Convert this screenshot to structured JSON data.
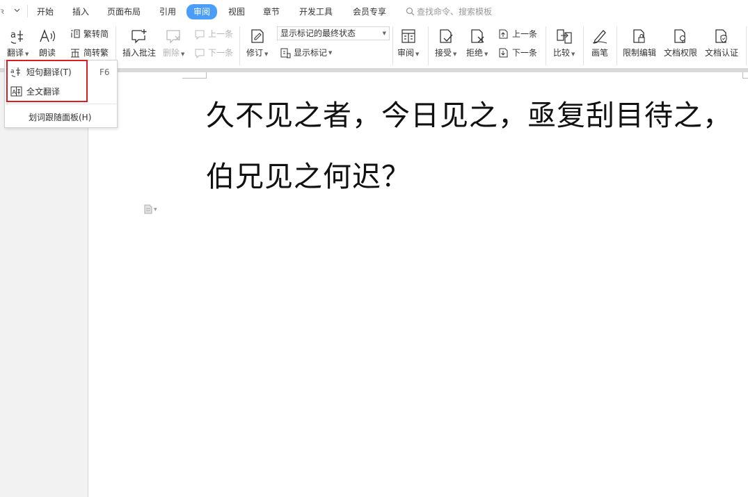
{
  "tabs": [
    "开始",
    "插入",
    "页面布局",
    "引用",
    "审阅",
    "视图",
    "章节",
    "开发工具",
    "会员专享"
  ],
  "active_tab": "审阅",
  "search_placeholder": "查找命令、搜索模板",
  "ribbon": {
    "translate": "翻译",
    "read_aloud": "朗读",
    "trad_to_simp": "繁转简",
    "simp_to_trad": "简转繁",
    "insert_comment": "插入批注",
    "delete": "删除",
    "prev_comment": "上一条",
    "next_comment": "下一条",
    "revise": "修订",
    "markup_state": "显示标记的最终状态",
    "show_markup": "显示标记",
    "review": "审阅",
    "accept": "接受",
    "reject": "拒绝",
    "prev_change": "上一条",
    "next_change": "下一条",
    "compare": "比较",
    "pen": "画笔",
    "restrict_edit": "限制编辑",
    "doc_permission": "文档权限",
    "doc_certify": "文档认证"
  },
  "menu": {
    "short_translate": "短句翻译(T)",
    "short_shortcut": "F6",
    "full_translate": "全文翻译",
    "word_panel": "划词跟随面板(H)"
  },
  "document": {
    "text": "久不见之者，今日见之，亟复刮目待之，伯兄见之何迟？"
  },
  "colors": {
    "active_tab": "#4a9df8",
    "highlight_border": "#d81e1e"
  }
}
